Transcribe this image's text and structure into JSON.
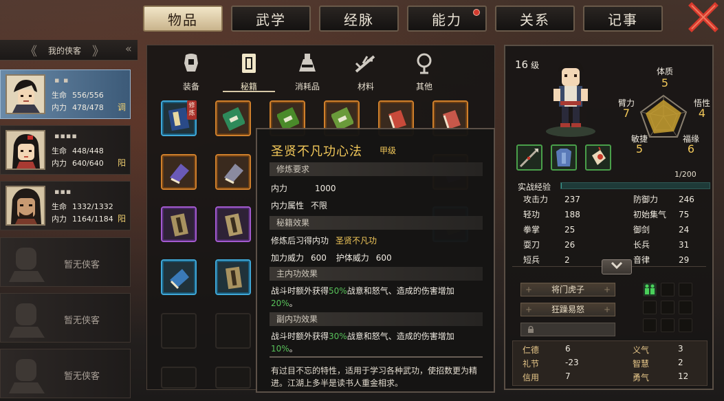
{
  "top_tabs": [
    {
      "label": "物品",
      "active": true,
      "notify": false
    },
    {
      "label": "武学",
      "active": false,
      "notify": false
    },
    {
      "label": "经脉",
      "active": false,
      "notify": false
    },
    {
      "label": "能力",
      "active": false,
      "notify": true
    },
    {
      "label": "关系",
      "active": false,
      "notify": false
    },
    {
      "label": "记事",
      "active": false,
      "notify": false
    }
  ],
  "roster": {
    "title": "我的侠客",
    "heroes": [
      {
        "name": "▪ ▪",
        "hp_label": "生命",
        "hp": "556/556",
        "mp_label": "内力",
        "mp": "478/478",
        "mode": "调",
        "active": true
      },
      {
        "name": "▪▪▪▪",
        "hp_label": "生命",
        "hp": "448/448",
        "mp_label": "内力",
        "mp": "640/640",
        "mode": "阳",
        "active": false
      },
      {
        "name": "▪▪▪",
        "hp_label": "生命",
        "hp": "1332/1332",
        "mp_label": "内力",
        "mp": "1164/1184",
        "mode": "阳",
        "active": false
      }
    ],
    "empty_label": "暂无侠客"
  },
  "categories": [
    {
      "label": "装备",
      "icon": "equipment-icon"
    },
    {
      "label": "秘籍",
      "icon": "scroll-book-icon"
    },
    {
      "label": "消耗品",
      "icon": "potion-icon"
    },
    {
      "label": "材料",
      "icon": "herb-icon"
    },
    {
      "label": "其他",
      "icon": "misc-icon"
    }
  ],
  "inventory_first_tag": "修炼",
  "tooltip": {
    "title": "圣贤不凡功心法",
    "grade": "甲级",
    "sec_requirements": "修炼要求",
    "req_neili_label": "内力",
    "req_neili_value": "1000",
    "req_attr_label": "内力属性",
    "req_attr_value": "不限",
    "sec_effects": "秘籍效果",
    "learn_label": "修炼后习得内功",
    "learn_value": "圣贤不凡功",
    "atk_label": "加力威力",
    "atk_value": "600",
    "def_label": "护体威力",
    "def_value": "600",
    "sec_main": "主内功效果",
    "main_pre": "战斗时额外获得",
    "main_pct": "50%",
    "main_mid": "战意和怒气、造成的伤害增加",
    "main_pct2": "20%",
    "main_end": "。",
    "sec_sub": "副内功效果",
    "sub_pre": "战斗时额外获得",
    "sub_pct": "30%",
    "sub_mid": "战意和怒气、造成的伤害增加",
    "sub_pct2": "10%",
    "sub_end": "。",
    "description": "有过目不忘的特性，适用于学习各种武功，使招数更为精进。江湖上多半是读书人重金相求。"
  },
  "character": {
    "level": "16",
    "level_unit": "级",
    "attrs": {
      "tizhi": {
        "label": "体质",
        "value": "5"
      },
      "bili": {
        "label": "臂力",
        "value": "7"
      },
      "wuxing": {
        "label": "悟性",
        "value": "4"
      },
      "minjie": {
        "label": "敏捷",
        "value": "5"
      },
      "fuyuan": {
        "label": "福缘",
        "value": "6"
      }
    },
    "equip_icons": [
      "spear-icon",
      "armor-icon",
      "accessory-icon"
    ],
    "exp_label": "实战经验",
    "exp": "1/200",
    "exp_fraction": 0.005,
    "stats_left": [
      {
        "label": "攻击力",
        "value": "237"
      },
      {
        "label": "轻功",
        "value": "188"
      },
      {
        "label": "拳掌",
        "value": "25"
      },
      {
        "label": "耍刀",
        "value": "26"
      },
      {
        "label": "短兵",
        "value": "2"
      }
    ],
    "stats_right": [
      {
        "label": "防御力",
        "value": "246"
      },
      {
        "label": "初始集气",
        "value": "75"
      },
      {
        "label": "御剑",
        "value": "24"
      },
      {
        "label": "长兵",
        "value": "31"
      },
      {
        "label": "音律",
        "value": "29"
      }
    ],
    "skills": [
      "将门虎子",
      "狂躁易怒",
      ""
    ],
    "morals_left": [
      {
        "label": "仁德",
        "value": "6"
      },
      {
        "label": "礼节",
        "value": "-23"
      },
      {
        "label": "信用",
        "value": "7"
      }
    ],
    "morals_right": [
      {
        "label": "义气",
        "value": "3"
      },
      {
        "label": "智慧",
        "value": "2"
      },
      {
        "label": "勇气",
        "value": "12"
      }
    ]
  },
  "colors": {
    "accent_gold": "#f2c85a",
    "highlight_green": "#58c25a",
    "close_red": "#d8392c"
  }
}
